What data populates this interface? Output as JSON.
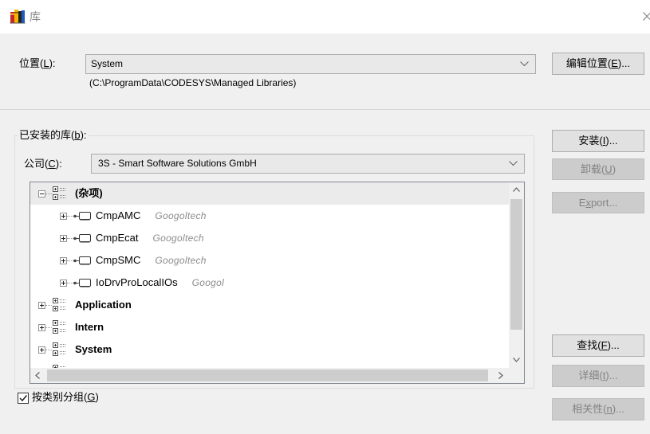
{
  "window": {
    "title": "库"
  },
  "location": {
    "label": {
      "pre": "位置(",
      "key": "L",
      "post": "):"
    },
    "selected": "System",
    "path": "(C:\\ProgramData\\CODESYS\\Managed Libraries)",
    "edit_button": {
      "pre": "编辑位置(",
      "key": "E",
      "post": ")...",
      "enabled": true
    }
  },
  "installed": {
    "group_label": {
      "pre": "已安装的库(",
      "key": "b",
      "post": "):"
    },
    "company": {
      "label": {
        "pre": "公司(",
        "key": "C",
        "post": "):"
      },
      "selected": "3S - Smart Software Solutions GmbH"
    },
    "tree": {
      "items": [
        {
          "level": 0,
          "name": "(杂项)",
          "icon": "category-icon",
          "expanded": true,
          "highlighted": true
        },
        {
          "level": 1,
          "name": "CmpAMC",
          "vendor": "Googoltech",
          "icon": "library-icon",
          "expanded": false
        },
        {
          "level": 1,
          "name": "CmpEcat",
          "vendor": "Googoltech",
          "icon": "library-icon",
          "expanded": false
        },
        {
          "level": 1,
          "name": "CmpSMC",
          "vendor": "Googoltech",
          "icon": "library-icon",
          "expanded": false
        },
        {
          "level": 1,
          "name": "IoDrvProLocalIOs",
          "vendor": "Googol",
          "icon": "library-icon",
          "expanded": false
        },
        {
          "level": 0,
          "name": "Application",
          "icon": "category-icon",
          "expanded": false
        },
        {
          "level": 0,
          "name": "Intern",
          "icon": "category-icon",
          "expanded": false
        },
        {
          "level": 0,
          "name": "System",
          "icon": "category-icon",
          "expanded": false
        },
        {
          "level": 0,
          "name": "",
          "icon": "category-icon",
          "expanded": false
        }
      ]
    },
    "group_by_category": {
      "checked": true,
      "label": {
        "pre": "按类别分组(",
        "key": "G",
        "post": ")"
      }
    }
  },
  "buttons": {
    "install": {
      "pre": "安装(",
      "key": "I",
      "post": ")...",
      "enabled": true
    },
    "uninstall": {
      "pre": "卸载(",
      "key": "U",
      "post": ")",
      "enabled": false
    },
    "export": {
      "pre": "E",
      "key": "x",
      "post": "port...",
      "enabled": false
    },
    "find": {
      "pre": "查找(",
      "key": "F",
      "post": ")...",
      "enabled": true
    },
    "details": {
      "pre": "详细(",
      "key": "t",
      "post": ")...",
      "enabled": false
    },
    "dependencies": {
      "pre": "相关性(",
      "key": "n",
      "post": ")...",
      "enabled": false
    }
  },
  "colors": {
    "vendor_text": "#8c8c8c",
    "disabled_text": "#838383",
    "row_highlight": "#ebebeb"
  }
}
